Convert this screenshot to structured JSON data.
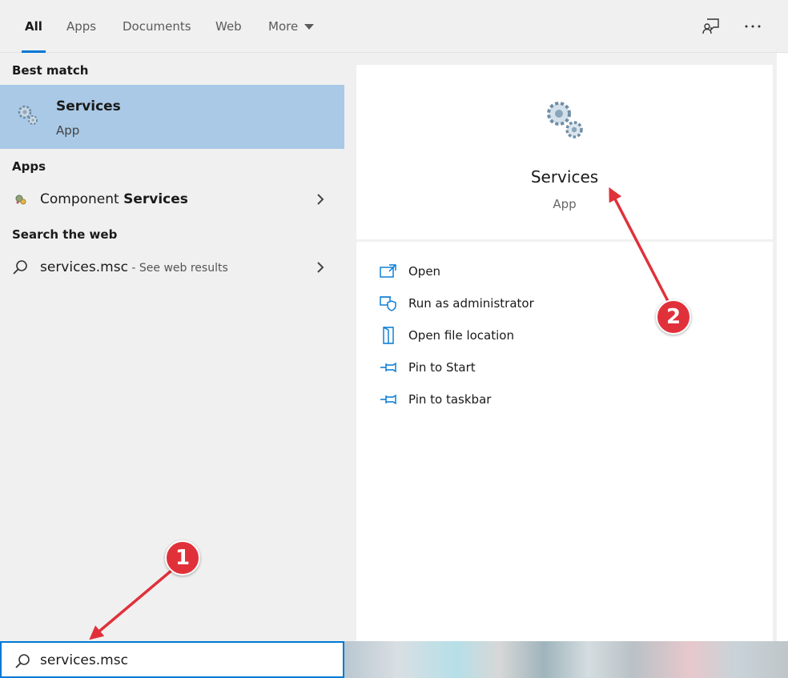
{
  "colors": {
    "accent": "#0078d4",
    "selection": "#a9c9e6",
    "annotation_red": "#e0313a"
  },
  "tabs": [
    {
      "label": "All",
      "active": true
    },
    {
      "label": "Apps",
      "active": false
    },
    {
      "label": "Documents",
      "active": false
    },
    {
      "label": "Web",
      "active": false
    },
    {
      "label": "More",
      "active": false
    }
  ],
  "top_icons": [
    "feedback-icon",
    "more-options-icon"
  ],
  "left": {
    "best_match_header": "Best match",
    "best_match": {
      "title": "Services",
      "subtitle": "App",
      "icon": "gears-icon"
    },
    "apps_header": "Apps",
    "app_item": {
      "prefix": "Component ",
      "bold": "Services",
      "icon": "component-services-icon"
    },
    "web_header": "Search the web",
    "web_item": {
      "query": "services.msc",
      "suffix": " - See web results",
      "icon": "search-icon"
    }
  },
  "preview": {
    "title": "Services",
    "subtitle": "App",
    "icon": "gears-icon"
  },
  "actions": [
    {
      "label": "Open",
      "icon": "open-icon"
    },
    {
      "label": "Run as administrator",
      "icon": "shield-icon"
    },
    {
      "label": "Open file location",
      "icon": "folder-location-icon"
    },
    {
      "label": "Pin to Start",
      "icon": "pin-icon"
    },
    {
      "label": "Pin to taskbar",
      "icon": "pin-icon"
    }
  ],
  "search": {
    "value": "services.msc",
    "icon": "search-icon"
  },
  "annotations": [
    {
      "number": "1"
    },
    {
      "number": "2"
    }
  ]
}
